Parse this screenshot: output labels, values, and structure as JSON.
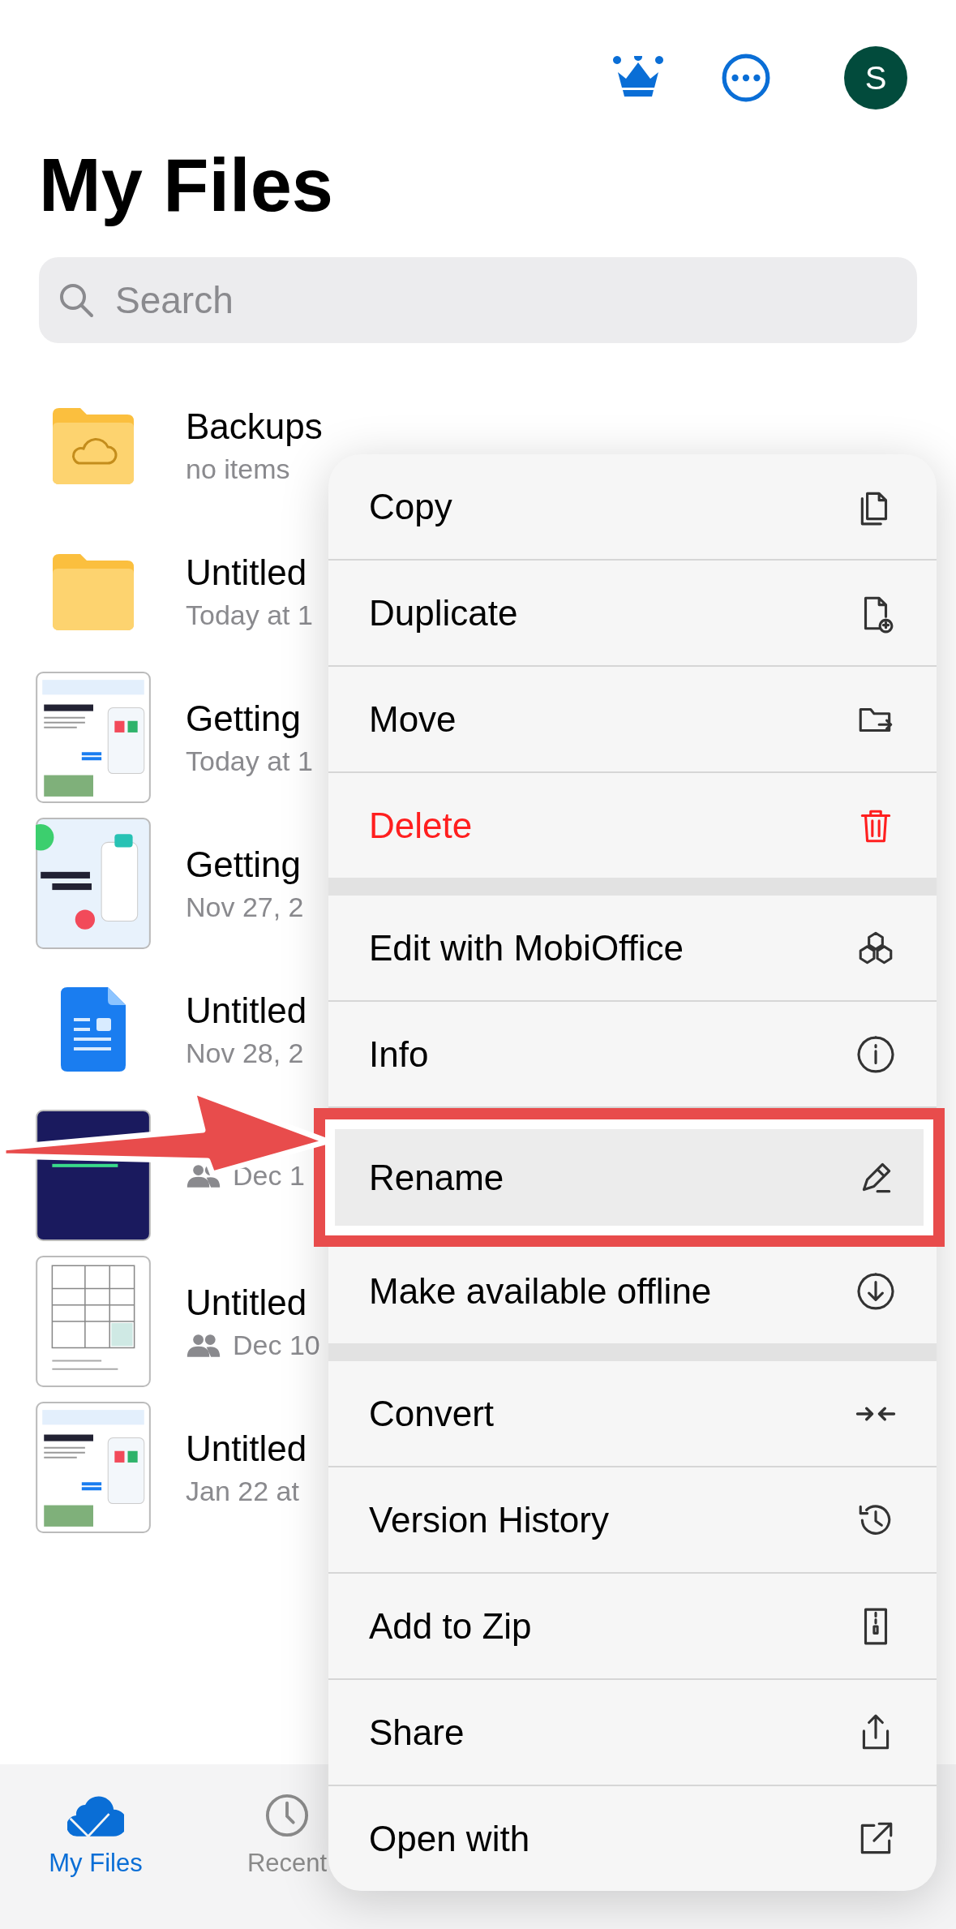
{
  "header": {
    "avatar_initial": "S"
  },
  "title": "My Files",
  "search": {
    "placeholder": "Search"
  },
  "files": [
    {
      "kind": "cloud-folder",
      "name": "Backups",
      "meta": "no items",
      "shared": false
    },
    {
      "kind": "folder",
      "name": "Untitled",
      "meta": "Today at 1",
      "shared": false
    },
    {
      "kind": "preview-light",
      "name": "Getting",
      "meta": "Today at 1",
      "shared": false
    },
    {
      "kind": "preview-promo",
      "name": "Getting",
      "meta": "Nov 27, 2",
      "shared": false
    },
    {
      "kind": "doc",
      "name": "Untitled",
      "meta": "Nov 28, 2",
      "shared": false
    },
    {
      "kind": "preview-dark",
      "meta": "Dec 1",
      "shared": true
    },
    {
      "kind": "preview-table",
      "name": "Untitled",
      "meta": "Dec 10",
      "shared": true
    },
    {
      "kind": "preview-light",
      "name": "Untitled",
      "meta": "Jan 22 at",
      "shared": false
    }
  ],
  "menu": {
    "groups": [
      [
        {
          "label": "Copy",
          "destructive": false,
          "highlighted": false
        },
        {
          "label": "Duplicate",
          "destructive": false,
          "highlighted": false
        },
        {
          "label": "Move",
          "destructive": false,
          "highlighted": false
        },
        {
          "label": "Delete",
          "destructive": true,
          "highlighted": false
        }
      ],
      [
        {
          "label": "Edit with MobiOffice",
          "destructive": false,
          "highlighted": false
        },
        {
          "label": "Info",
          "destructive": false,
          "highlighted": false
        },
        {
          "label": "Rename",
          "destructive": false,
          "highlighted": true
        },
        {
          "label": "Make available offline",
          "destructive": false,
          "highlighted": false
        }
      ],
      [
        {
          "label": "Convert",
          "destructive": false,
          "highlighted": false
        },
        {
          "label": "Version History",
          "destructive": false,
          "highlighted": false
        },
        {
          "label": "Add to Zip",
          "destructive": false,
          "highlighted": false
        },
        {
          "label": "Share",
          "destructive": false,
          "highlighted": false
        },
        {
          "label": "Open with",
          "destructive": false,
          "highlighted": false
        }
      ]
    ]
  },
  "tabs": [
    {
      "label": "My Files",
      "selected": true
    },
    {
      "label": "Recent",
      "selected": false
    }
  ]
}
